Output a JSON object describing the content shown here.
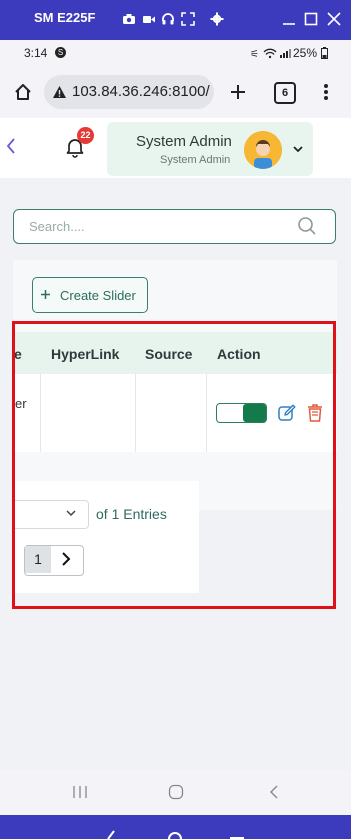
{
  "window": {
    "title": "SM E225F"
  },
  "status": {
    "time": "3:14",
    "notification_letter": "S",
    "battery": "25%"
  },
  "browser": {
    "url": "103.84.36.246:8100/a",
    "tab_count": "6"
  },
  "header": {
    "notification_count": "22",
    "user_name": "System Admin",
    "user_role": "System Admin"
  },
  "search": {
    "placeholder": "Search...."
  },
  "toolbar": {
    "create_label": "Create Slider"
  },
  "table": {
    "columns": [
      "e",
      "HyperLink",
      "Source",
      "Action"
    ],
    "rows": [
      {
        "partial_text": "er",
        "hyperlink": "",
        "source": "",
        "status_on": true
      }
    ]
  },
  "pagination": {
    "entries_label": "of 1 Entries",
    "current_page": "1"
  },
  "colors": {
    "accent": "#3b7d6f",
    "toggle_on": "#137a4c",
    "badge": "#e53935",
    "highlight": "#e01018",
    "chrome": "#3c3bbd"
  }
}
